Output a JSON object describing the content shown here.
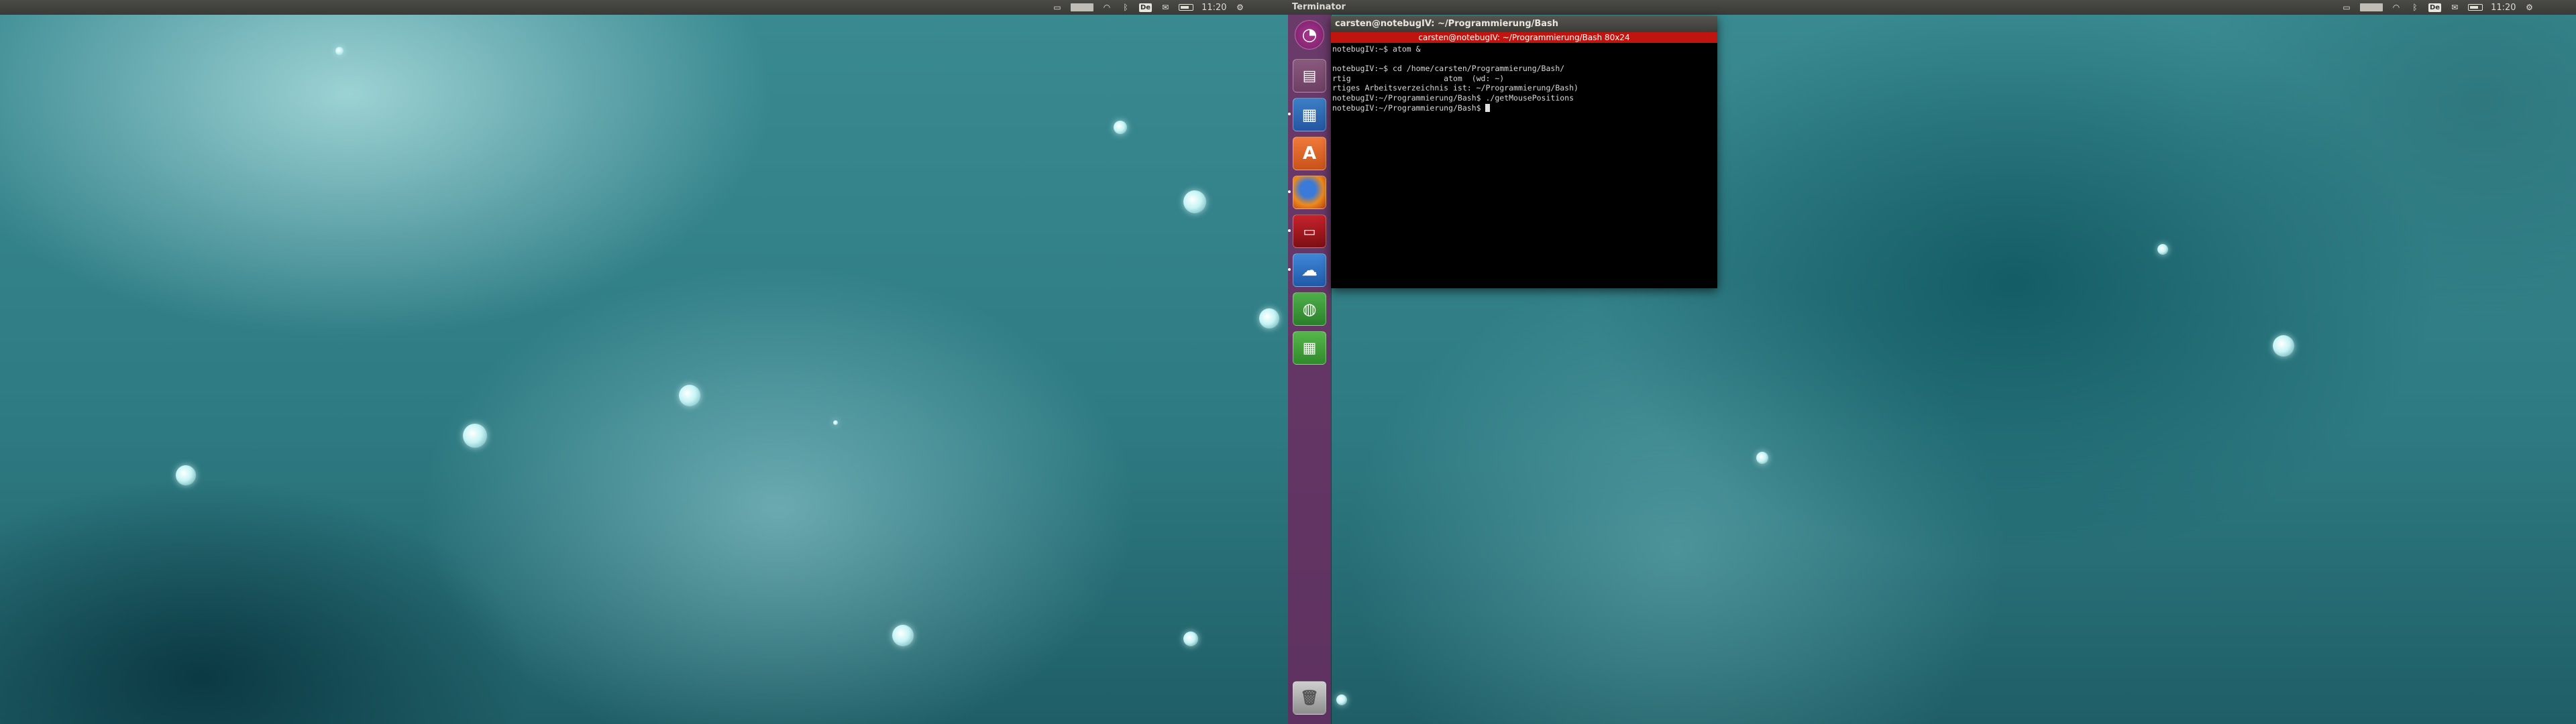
{
  "screen_left": {
    "top_panel": {
      "app_title": "",
      "clock": "11:20",
      "keyboard_layout": "De"
    }
  },
  "screen_right": {
    "top_panel": {
      "app_title": "Terminator",
      "clock": "11:20",
      "keyboard_layout": "De"
    },
    "launcher": {
      "items": [
        {
          "icon": "ubuntu-dash-icon"
        },
        {
          "icon": "file-manager-icon"
        },
        {
          "icon": "text-editor-icon"
        },
        {
          "icon": "software-center-icon"
        },
        {
          "icon": "firefox-icon"
        },
        {
          "icon": "terminator-icon"
        },
        {
          "icon": "dropbox-icon"
        },
        {
          "icon": "network-globe-icon"
        },
        {
          "icon": "spreadsheet-icon"
        }
      ],
      "trash": {
        "icon": "trash-icon"
      }
    },
    "terminal": {
      "window_title": "carsten@notebugIV: ~/Programmierung/Bash",
      "tab_title": "carsten@notebugIV: ~/Programmierung/Bash 80x24",
      "lines": [
        "notebugIV:~$ atom &",
        "",
        "notebugIV:~$ cd /home/carsten/Programmierung/Bash/",
        "rtig                    atom  (wd: ~)",
        "rtiges Arbeitsverzeichnis ist: ~/Programmierung/Bash)",
        "notebugIV:~/Programmierung/Bash$ ./getMousePositions",
        "notebugIV:~/Programmierung/Bash$ "
      ]
    }
  },
  "colors": {
    "terminal_tab_red": "#c0150f",
    "launcher_purple": "#6a3a6a",
    "panel_dark": "#3c3b37"
  }
}
